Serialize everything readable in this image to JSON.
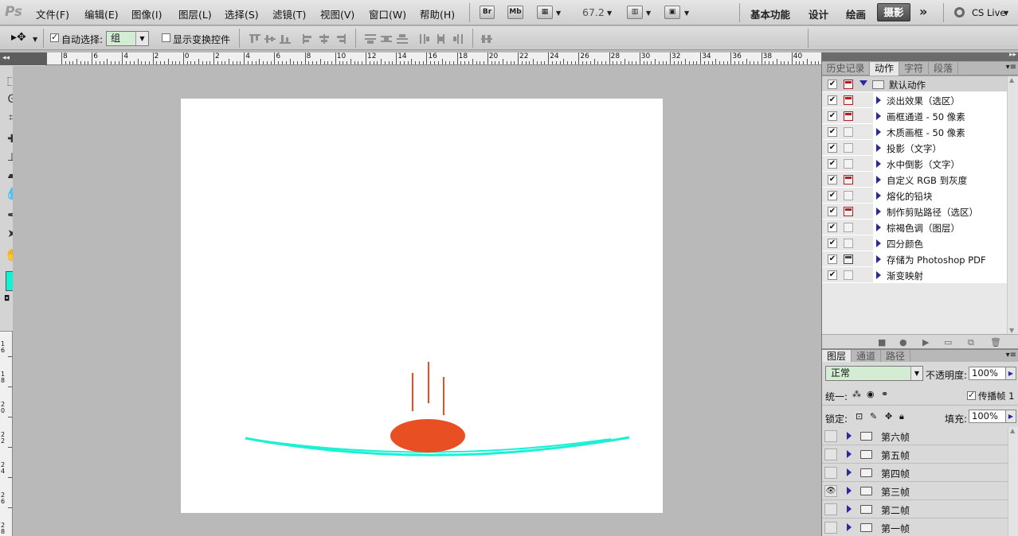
{
  "app": {
    "logo": "Ps",
    "zoom": "67.2"
  },
  "menu": [
    "文件(F)",
    "编辑(E)",
    "图像(I)",
    "图层(L)",
    "选择(S)",
    "滤镜(T)",
    "视图(V)",
    "窗口(W)",
    "帮助(H)"
  ],
  "menubar_buttons": {
    "bridge": "Br",
    "minibridge": "Mb"
  },
  "workspaces": {
    "basic": "基本功能",
    "design": "设计",
    "painting": "绘画",
    "photography": "摄影",
    "more": "»",
    "cs_live": "CS Live"
  },
  "options": {
    "auto_select_label": "自动选择:",
    "auto_select_checked": true,
    "auto_select_value": "组",
    "show_transform_label": "显示变换控件",
    "show_transform_checked": false
  },
  "ruler_top": [
    "8",
    "6",
    "4",
    "2",
    "0",
    "2",
    "4",
    "6",
    "8",
    "10",
    "12",
    "14",
    "16",
    "18",
    "20",
    "22",
    "24",
    "26",
    "28",
    "30",
    "32",
    "34",
    "36",
    "38",
    "40"
  ],
  "ruler_left": [
    "1 6",
    "1 8",
    "2 0",
    "2 2",
    "2 4",
    "2 6",
    "2 8"
  ],
  "colors": {
    "foreground": "#11f2d6",
    "background": "#ffffff",
    "ball": "#e84f22",
    "rope": "#1cf0d4"
  },
  "panel_top_tabs": [
    "历史记录",
    "动作",
    "字符",
    "段落"
  ],
  "actions": {
    "set_name": "默认动作",
    "items": [
      {
        "label": "淡出效果（选区）",
        "dialog": "red"
      },
      {
        "label": "画框通道 - 50 像素",
        "dialog": "red"
      },
      {
        "label": "木质画框 - 50 像素",
        "dialog": ""
      },
      {
        "label": "投影（文字）",
        "dialog": ""
      },
      {
        "label": "水中倒影（文字）",
        "dialog": ""
      },
      {
        "label": "自定义 RGB 到灰度",
        "dialog": "red"
      },
      {
        "label": "熔化的铅块",
        "dialog": ""
      },
      {
        "label": "制作剪贴路径（选区）",
        "dialog": "red"
      },
      {
        "label": "棕褐色调（图层）",
        "dialog": ""
      },
      {
        "label": "四分颜色",
        "dialog": ""
      },
      {
        "label": "存储为 Photoshop PDF",
        "dialog": "dark"
      },
      {
        "label": "渐变映射",
        "dialog": ""
      }
    ]
  },
  "layers_tabs": [
    "图层",
    "通道",
    "路径"
  ],
  "layers": {
    "blend_mode": "正常",
    "opacity_label": "不透明度:",
    "opacity": "100%",
    "unify_label": "统一:",
    "propagate_label": "传播帧 1",
    "lock_label": "锁定:",
    "fill_label": "填充:",
    "fill": "100%",
    "groups": [
      {
        "name": "第六帧",
        "visible": false
      },
      {
        "name": "第五帧",
        "visible": false
      },
      {
        "name": "第四帧",
        "visible": false
      },
      {
        "name": "第三帧",
        "visible": true
      },
      {
        "name": "第二帧",
        "visible": false
      },
      {
        "name": "第一帧",
        "visible": false
      }
    ]
  }
}
